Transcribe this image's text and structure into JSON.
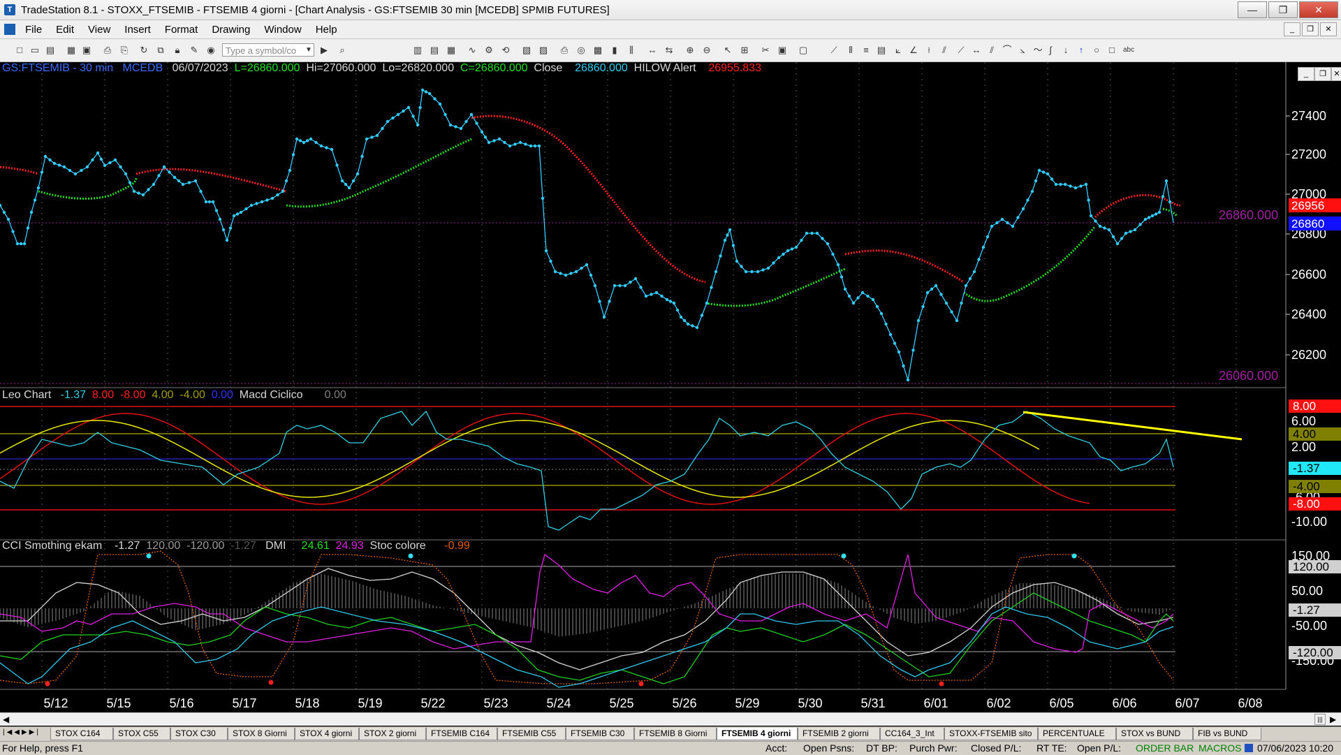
{
  "window": {
    "title": "TradeStation 8.1 - STOXX_FTSEMIB - FTSEMIB 4 giorni - [Chart Analysis - GS:FTSEMIB 30 min [MCEDB] SPMIB FUTURES]",
    "min": "—",
    "max": "❐",
    "close": "✕"
  },
  "menu": [
    "File",
    "Edit",
    "View",
    "Insert",
    "Format",
    "Drawing",
    "Window",
    "Help"
  ],
  "toolbar": {
    "symbol_placeholder": "Type a symbol/co"
  },
  "price_pane": {
    "symbol": "GS:FTSEMIB - 30 min",
    "datafeed": "MCEDB",
    "date": "06/07/2023",
    "last": "L=26860.000",
    "high": "Hi=27060.000",
    "low": "Lo=26820.000",
    "close_c": "C=26860.000",
    "close_label": "Close",
    "close_val": "26860.000",
    "alert_label": "HILOW Alert",
    "alert_val": "26955.833",
    "axis_ticks": [
      "27400",
      "27200",
      "27000",
      "26800",
      "26600",
      "26400",
      "26200"
    ],
    "line_high_label": "26860.000",
    "line_low_label": "26060.000",
    "tag_red": "26956",
    "tag_blue": "26860",
    "colors": {
      "price": "#33ccff",
      "hilow_red": "#ff2020",
      "hilow_green": "#22dd22"
    }
  },
  "leo_pane": {
    "name": "Leo Chart",
    "v1": "-1.37",
    "v2": "8.00",
    "v3": "-8.00",
    "v4": "4.00",
    "v5": "-4.00",
    "v6": "0.00",
    "name2": "Macd Ciclico",
    "v7": "0.00",
    "axis_ticks": [
      "6.00",
      "2.00",
      "-6.00",
      "-10.00"
    ],
    "tags": [
      "8.00",
      "4.00",
      "-1.37",
      "-4.00",
      "-8.00"
    ]
  },
  "cci_pane": {
    "name": "CCI Smothing ekam",
    "v1": "-1.27",
    "v2": "120.00",
    "v3": "-120.00",
    "v4": "-1.27",
    "dmi_label": "DMI",
    "dmi_plus": "24.61",
    "dmi_minus": "24.93",
    "stoc_label": "Stoc colore",
    "stoc_val": "-0.99",
    "axis_ticks": [
      "150.00",
      "50.00",
      "-50.00",
      "-150.00"
    ],
    "tags": [
      "120.00",
      "-1.27",
      "-120.00"
    ]
  },
  "dates": [
    "5/12",
    "5/15",
    "5/16",
    "5/17",
    "5/18",
    "5/19",
    "5/22",
    "5/23",
    "5/24",
    "5/25",
    "5/26",
    "5/29",
    "5/30",
    "5/31",
    "6/01",
    "6/02",
    "6/05",
    "6/06",
    "6/07",
    "6/08"
  ],
  "tabs": [
    "STOX C164",
    "STOX C55",
    "STOX  C30",
    "STOX  8 Giorni",
    "STOX 4 giorni",
    "STOX  2 giorni",
    "FTSEMIB C164",
    "FTSEMIB C55",
    "FTSEMIB C30",
    "FTSEMIB  8 Giorni",
    "FTSEMIB  4 giorni",
    "FTSEMIB  2 giorni",
    "CC164_3_Int",
    "STOXX-FTSEMIB sito",
    "PERCENTUALE",
    "STOX vs BUND",
    "FIB vs BUND"
  ],
  "status": {
    "help": "For Help, press F1",
    "acct": "Acct:",
    "open_psns": "Open Psns:",
    "dt_bp": "DT BP:",
    "purch_pwr": "Purch Pwr:",
    "closed_pl": "Closed P/L:",
    "rt_te": "RT TE:",
    "open_pl": "Open P/L:",
    "order_bar": "ORDER BAR",
    "macros": "MACROS",
    "datetime": "07/06/2023 10:20"
  }
}
